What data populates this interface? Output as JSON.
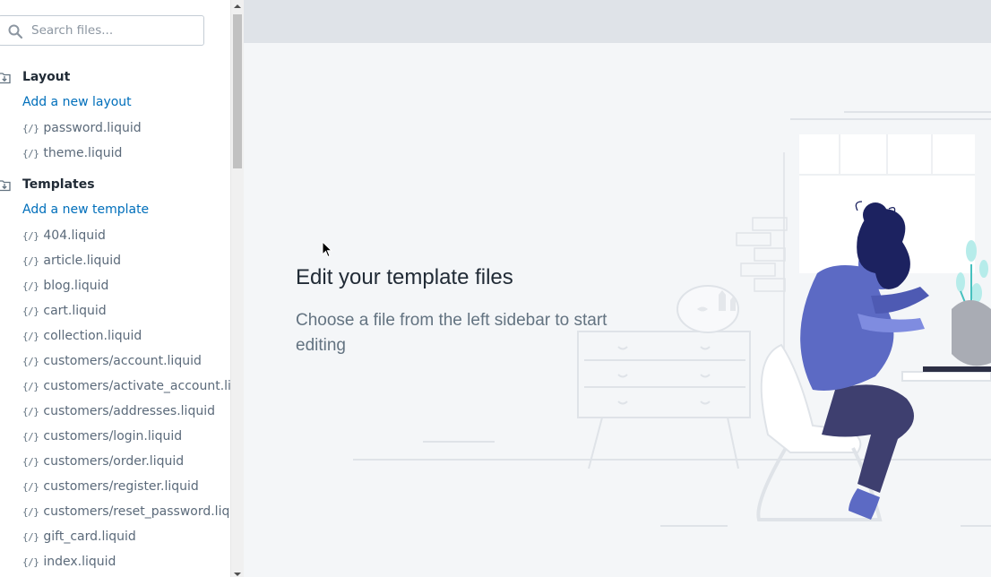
{
  "sidebar": {
    "search_placeholder": "Search files...",
    "sections": {
      "layout": {
        "title": "Layout",
        "add_label": "Add a new layout",
        "files": [
          "password.liquid",
          "theme.liquid"
        ]
      },
      "templates": {
        "title": "Templates",
        "add_label": "Add a new template",
        "files": [
          "404.liquid",
          "article.liquid",
          "blog.liquid",
          "cart.liquid",
          "collection.liquid",
          "customers/account.liquid",
          "customers/activate_account.liquid",
          "customers/addresses.liquid",
          "customers/login.liquid",
          "customers/order.liquid",
          "customers/register.liquid",
          "customers/reset_password.liquid",
          "gift_card.liquid",
          "index.liquid"
        ]
      }
    },
    "file_icon_glyph": "{/}"
  },
  "main": {
    "empty_state": {
      "title": "Edit your template files",
      "description": "Choose a file from the left sidebar to start editing"
    }
  },
  "icons": {
    "search": "search-icon",
    "folder": "folder-download-icon",
    "file": "code-file-icon"
  },
  "colors": {
    "link": "#006fbb",
    "heading": "#212b36",
    "muted": "#637381",
    "topbar": "#dfe3e8",
    "canvas": "#f4f6f8",
    "illustration_primary": "#5c6ac4",
    "illustration_dark": "#1c2260"
  }
}
